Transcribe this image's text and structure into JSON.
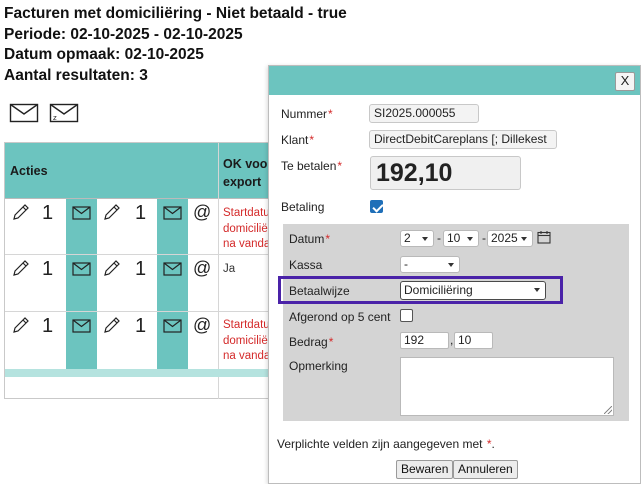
{
  "report": {
    "title": "Facturen met domiciliëring - Niet betaald - true",
    "period": "Periode: 02-10-2025 - 02-10-2025",
    "date": "Datum opmaak: 02-10-2025",
    "results": "Aantal resultaten: 3"
  },
  "table": {
    "headers": {
      "acties": "Acties",
      "ok_line1": "OK voor",
      "ok_line2": "export"
    },
    "rows": [
      {
        "count_a": "1",
        "count_b": "1",
        "ok_lines": [
          "Startdatu",
          "domicilië",
          "na vanda"
        ],
        "ok_status": "error"
      },
      {
        "count_a": "1",
        "count_b": "1",
        "ok_lines": [
          "Ja"
        ],
        "ok_status": "ok"
      },
      {
        "count_a": "1",
        "count_b": "1",
        "ok_lines": [
          "Startdatu",
          "domicilië",
          "na vanda"
        ],
        "ok_status": "error"
      }
    ]
  },
  "dialog": {
    "close_label": "X",
    "nummer_label": "Nummer",
    "nummer_value": "SI2025.000055",
    "klant_label": "Klant",
    "klant_value": "DirectDebitCareplans  [;  Dillekest",
    "te_betalen_label": "Te betalen",
    "te_betalen_value": "192,10",
    "betaling_label": "Betaling",
    "betaling_checked": true,
    "datum_label": "Datum",
    "datum_day": "2",
    "datum_month": "10",
    "datum_year": "2025",
    "datum_sep": "-",
    "kassa_label": "Kassa",
    "kassa_value": "-",
    "betaalwijze_label": "Betaalwijze",
    "betaalwijze_value": "Domiciliëring",
    "afgerond_label": "Afgerond op 5 cent",
    "afgerond_checked": false,
    "bedrag_label": "Bedrag",
    "bedrag_units": "192",
    "bedrag_sep": ",",
    "bedrag_cents": "10",
    "opmerking_label": "Opmerking",
    "opmerking_value": "",
    "required_mark": "*",
    "footer_text": "Verplichte velden zijn aangegeven met ",
    "footer_end": ".",
    "save_label": "Bewaren",
    "cancel_label": "Annuleren"
  },
  "colors": {
    "accent": "#6cc4bf",
    "required": "#d42a2a",
    "highlight": "#4a22a8",
    "checkbox": "#1f6fb8"
  },
  "icons": [
    "mail-icon",
    "mail-z-icon",
    "pencil-icon",
    "at-icon",
    "calendar-icon",
    "close-icon"
  ]
}
